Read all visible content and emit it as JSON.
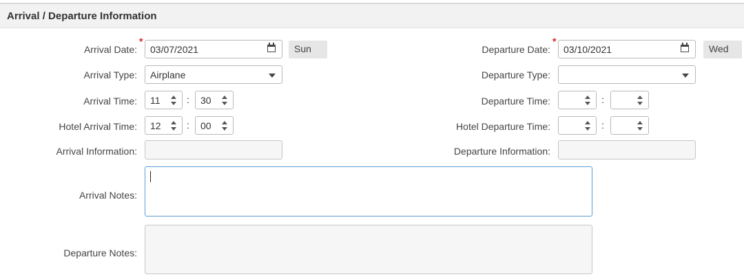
{
  "section": {
    "title": "Arrival / Departure Information"
  },
  "arrival": {
    "date_label": "Arrival Date:",
    "date_value": "03/07/2021",
    "day": "Sun",
    "type_label": "Arrival Type:",
    "type_value": "Airplane",
    "time_label": "Arrival Time:",
    "time_hour": "11",
    "time_minute": "30",
    "hotel_time_label": "Hotel Arrival Time:",
    "hotel_hour": "12",
    "hotel_minute": "00",
    "info_label": "Arrival Information:",
    "info_value": "",
    "notes_label": "Arrival Notes:",
    "notes_value": ""
  },
  "departure": {
    "date_label": "Departure Date:",
    "date_value": "03/10/2021",
    "day": "Wed",
    "type_label": "Departure Type:",
    "type_value": "",
    "time_label": "Departure Time:",
    "time_hour": "",
    "time_minute": "",
    "hotel_time_label": "Hotel Departure Time:",
    "hotel_hour": "",
    "hotel_minute": "",
    "info_label": "Departure Information:",
    "info_value": "",
    "notes_label": "Departure Notes:",
    "notes_value": ""
  },
  "ui": {
    "time_separator": ":",
    "required_marker": "*"
  },
  "colors": {
    "required": "#e02020",
    "focus_border": "#5b9bd5",
    "header_bg": "#f2f2f2"
  }
}
